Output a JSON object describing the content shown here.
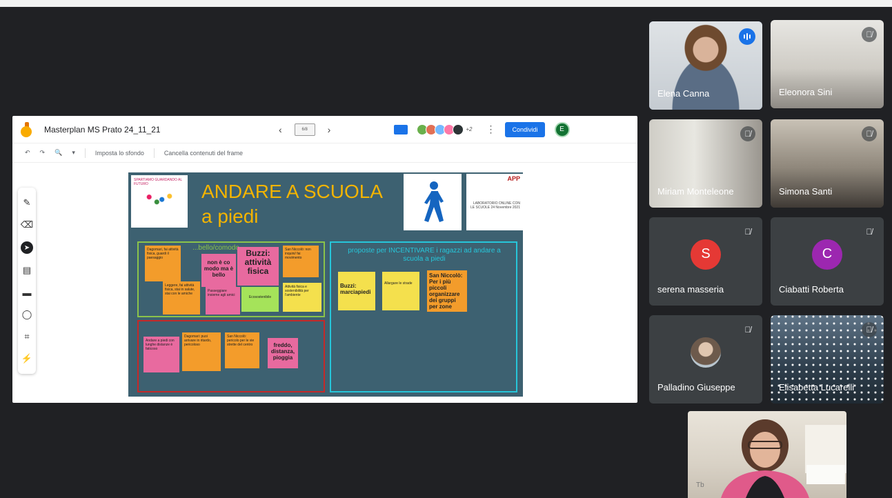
{
  "meeting": {
    "share_window": {
      "doc_title": "Masterplan MS Prato 24_11_21",
      "nav_prev": "‹",
      "nav_next": "›",
      "frame_indicator": "6/8",
      "collaborators_more": "+2",
      "menu_dots": "⋮",
      "share_label": "Condividi",
      "user_initial": "E",
      "toolbar": {
        "undo": "↶",
        "redo": "↷",
        "zoom": "🔍",
        "zoom_caret": "▾",
        "set_background": "Imposta lo sfondo",
        "clear_frame": "Cancella contenuti del frame"
      },
      "side_tools": [
        "✎",
        "⌫",
        "➤",
        "▤",
        "▬",
        "◯",
        "⌗",
        "⚡"
      ],
      "board": {
        "logo_text": "SPARTIAMO GUARDANDO AL FUTURO",
        "title_line1": "ANDARE A SCUOLA",
        "title_line2": "a piedi",
        "partner_app": "APP",
        "partner_caption": "LABORATORIO ONLINE CON LE SCUOLE 24 Novembre 2021",
        "green_area_head": "...bello/comodo",
        "red_area_head": "",
        "cyan_area_head": "proposte per INCENTIVARE i ragazzi ad andare a scuola a piedi",
        "notes": [
          {
            "id": "n1",
            "text": "Dagomari, fai attività fisica, guardi il paesaggio"
          },
          {
            "id": "n2",
            "text": "non è co modo ma è bello"
          },
          {
            "id": "n3",
            "text": "Buzzi: attività fisica"
          },
          {
            "id": "n4",
            "text": "San Niccolò: non inquini/ fai movimento"
          },
          {
            "id": "n5",
            "text": "Leggere, fai attività fisica, stai in salute, stai con le amiche"
          },
          {
            "id": "n6",
            "text": "Passeggiare insieme agli amici"
          },
          {
            "id": "n7",
            "text": "Ecosostenibile"
          },
          {
            "id": "n8",
            "text": "Attività fisica e sostenibilità per l'ambiente"
          },
          {
            "id": "n9",
            "text": "Buzzi: marciapiedi"
          },
          {
            "id": "n10",
            "text": "Allargare le strade"
          },
          {
            "id": "n11",
            "text": "San Niccolò: Per i più piccoli organizzare dei gruppi per zone"
          },
          {
            "id": "n12",
            "text": "Andare a piedi con lunghe distanze è faticoso"
          },
          {
            "id": "n13",
            "text": "Dagomari: puoi arrivare in ritardo, pericoloso"
          },
          {
            "id": "n14",
            "text": "San Niccolò: pericolo per le vie strette del centro"
          },
          {
            "id": "n15",
            "text": "freddo, distanza, pioggia"
          }
        ]
      }
    },
    "participants": [
      {
        "name": "Elena Canna",
        "state": "speaking"
      },
      {
        "name": "Eleonora Sini",
        "state": "muted"
      },
      {
        "name": "Miriam Monteleone",
        "state": "muted"
      },
      {
        "name": "Simona Santi",
        "state": "muted"
      },
      {
        "name": "serena masseria",
        "initial": "S",
        "state": "muted"
      },
      {
        "name": "Ciabatti Roberta",
        "initial": "C",
        "state": "muted"
      },
      {
        "name": "Palladino Giuseppe",
        "state": "muted"
      },
      {
        "name": "Elisabetta Lucarelli",
        "state": "muted"
      }
    ],
    "mic_off_icon": "🎙̸",
    "colors": {
      "accent": "#1a73e8",
      "background": "#202124",
      "tile": "#3c4043",
      "serena_avatar": "#e53935",
      "ciabatti_avatar": "#9c27b0"
    }
  }
}
